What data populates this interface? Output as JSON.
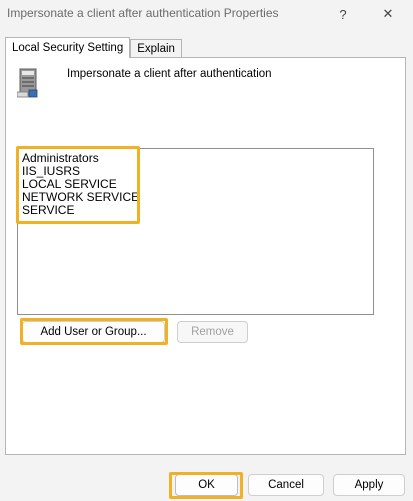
{
  "window": {
    "title": "Impersonate a client after authentication Properties",
    "help_label": "?",
    "close_label": "✕"
  },
  "tabs": [
    {
      "label": "Local Security Setting",
      "active": true
    },
    {
      "label": "Explain",
      "active": false
    }
  ],
  "policy": {
    "name": "Impersonate a client after authentication",
    "icon": "server-computer-icon"
  },
  "principals": [
    "Administrators",
    "IIS_IUSRS",
    "LOCAL SERVICE",
    "NETWORK SERVICE",
    "SERVICE"
  ],
  "buttons": {
    "add": "Add User or Group...",
    "remove": "Remove",
    "ok": "OK",
    "cancel": "Cancel",
    "apply": "Apply"
  },
  "colors": {
    "highlight": "#f0b125",
    "background": "#f3f3f3",
    "panel": "#ffffff"
  }
}
